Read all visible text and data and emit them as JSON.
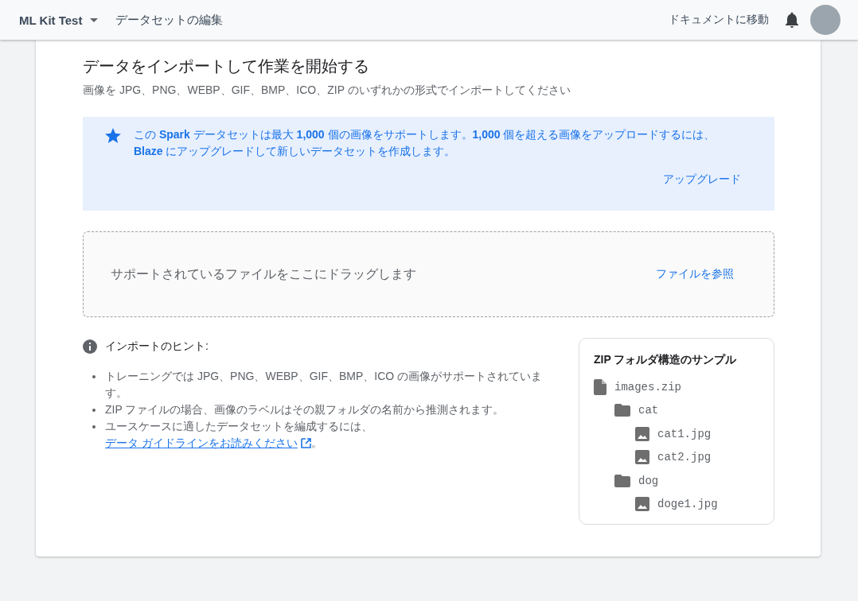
{
  "top_bar": {
    "project": "ML Kit Test",
    "page_title": "データセットの編集",
    "docs_link": "ドキュメントに移動"
  },
  "header": {
    "title": "データをインポートして作業を開始する",
    "subtitle": "画像を JPG、PNG、WEBP、GIF、BMP、ICO、ZIP のいずれかの形式でインポートしてください"
  },
  "notice": {
    "text": "この **Spark** データセットは最大 **1,000** 個の画像をサポートします。**1,000** 個を超える画像をアップロードするには、**Blaze** にアップグレードして新しいデータセットを作成します。",
    "action": "アップグレード"
  },
  "dropzone": {
    "hint": "サポートされているファイルをここにドラッグします",
    "browse": "ファイルを参照"
  },
  "tips": {
    "title": "インポートのヒント:",
    "items": [
      {
        "text": "トレーニングでは JPG、PNG、WEBP、GIF、BMP、ICO の画像がサポートされています。"
      },
      {
        "text": "ZIP ファイルの場合、画像のラベルはその親フォルダの名前から推測されます。"
      },
      {
        "text": "ユースケースに適したデータセットを編成するには、",
        "link": "データ ガイドラインをお読みください",
        "after": "。"
      }
    ]
  },
  "sample": {
    "title": "ZIP フォルダ構造のサンプル",
    "tree": [
      {
        "kind": "zip",
        "name": "images.zip",
        "children": [
          {
            "kind": "folder",
            "name": "cat",
            "children": [
              {
                "kind": "image",
                "name": "cat1.jpg"
              },
              {
                "kind": "image",
                "name": "cat2.jpg"
              }
            ]
          },
          {
            "kind": "folder",
            "name": "dog",
            "children": [
              {
                "kind": "image",
                "name": "doge1.jpg"
              }
            ]
          }
        ]
      }
    ]
  }
}
